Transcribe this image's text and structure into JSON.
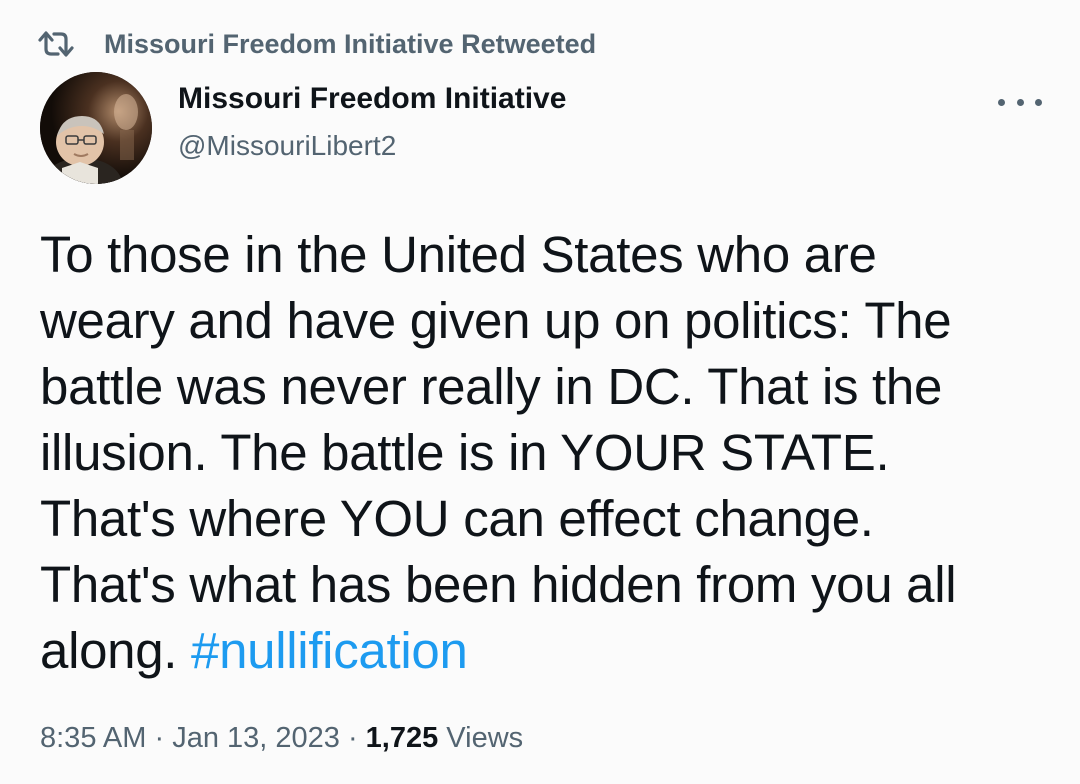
{
  "retweet_banner": {
    "icon": "retweet-icon",
    "text": "Missouri Freedom Initiative Retweeted"
  },
  "author": {
    "name": "Missouri Freedom Initiative",
    "handle": "@MissouriLibert2",
    "avatar_icon": "profile-photo"
  },
  "more_menu": {
    "icon": "more-horizontal-icon"
  },
  "tweet": {
    "lines": [
      "To those in the United States who are",
      "weary and have given up on politics: The",
      "battle was never really in DC. That is the",
      "illusion. The battle is in YOUR STATE.",
      "That's where YOU can effect change.",
      "That's what has been hidden from you all"
    ],
    "last_line_prefix": "along. ",
    "hashtag": "#nullification"
  },
  "meta": {
    "time": "8:35 AM",
    "separator1": " · ",
    "date": "Jan 13, 2023",
    "separator2": " · ",
    "views_count": "1,725",
    "views_label": " Views"
  },
  "colors": {
    "text_primary": "#0f1419",
    "text_secondary": "#536471",
    "link": "#1d9bf0",
    "background": "#fbfbfb"
  }
}
